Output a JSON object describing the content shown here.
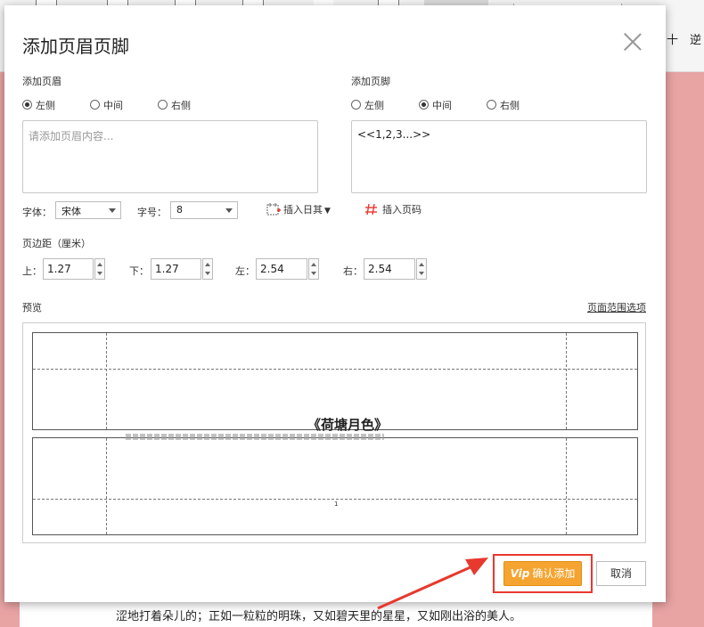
{
  "toolbar": {
    "right_texts": [
      "十",
      "逆"
    ]
  },
  "dialog": {
    "title": "添加页眉页脚",
    "header": {
      "label": "添加页眉",
      "align_options": [
        "左侧",
        "中间",
        "右侧"
      ],
      "selected": "左侧",
      "placeholder": "请添加页眉内容...",
      "value": ""
    },
    "footer": {
      "label": "添加页脚",
      "align_options": [
        "左侧",
        "中间",
        "右侧"
      ],
      "selected": "中间",
      "value": "<<1,2,3...>>"
    },
    "font": {
      "label": "字体：",
      "value": "宋体"
    },
    "size": {
      "label": "字号：",
      "value": "8"
    },
    "insert_date": "插入日其",
    "insert_page": "插入页码",
    "margins": {
      "label": "页边距（厘米）",
      "top": {
        "label": "上：",
        "value": "1.27"
      },
      "bottom": {
        "label": "下：",
        "value": "1.27"
      },
      "left": {
        "label": "左：",
        "value": "2.54"
      },
      "right": {
        "label": "右：",
        "value": "2.54"
      }
    },
    "preview": {
      "label": "预览",
      "range_link": "页面范围选项",
      "doc_title": "《荷塘月色》",
      "page_number": "1"
    },
    "buttons": {
      "confirm": "确认添加",
      "cancel": "取消"
    }
  },
  "document": {
    "visible_line": "涩地打着朵儿的；正如一粒粒的明珠，又如碧天里的星星，又如刚出浴的美人。"
  },
  "colors": {
    "accent": "#f5a431",
    "highlight": "#e8392e",
    "page_background": "#e8a3a3"
  }
}
